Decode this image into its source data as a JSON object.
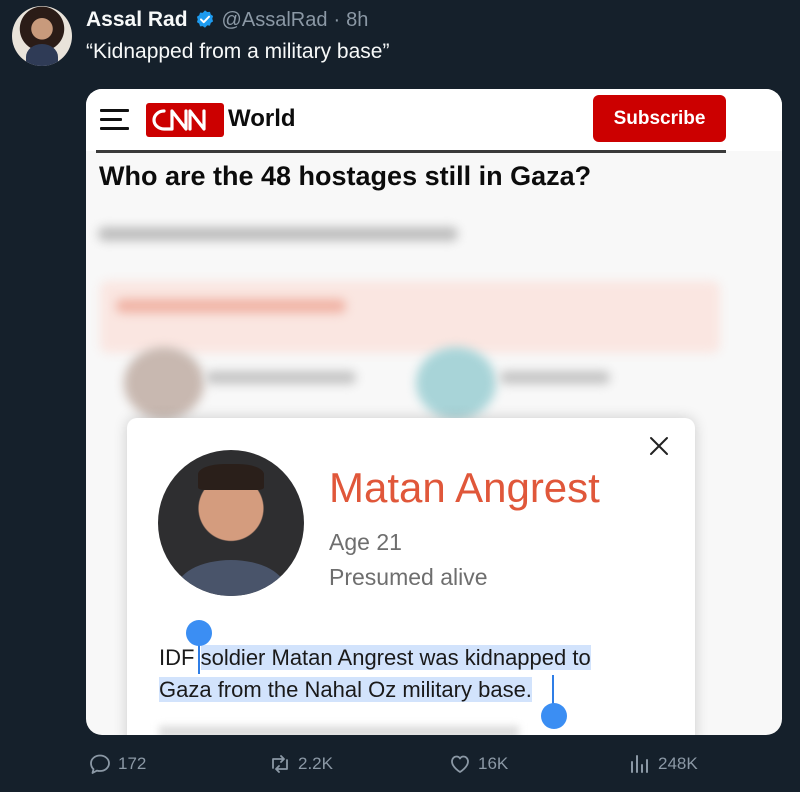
{
  "tweet": {
    "author_name": "Assal Rad",
    "handle": "@AssalRad",
    "separator": "·",
    "time": "8h",
    "text": "“Kidnapped from a military base”"
  },
  "cnn": {
    "section": "World",
    "subscribe_label": "Subscribe",
    "headline": "Who are the 48 hostages still in Gaza?",
    "brand_color": "#cc0000"
  },
  "modal": {
    "name": "Matan Angrest",
    "age": "Age 21",
    "status": "Presumed alive",
    "bio_prefix": "IDF",
    "bio_highlight_1": "soldier Matan Angrest was kidnapped to",
    "bio_highlight_2": "Gaza from the Nahal Oz military base.",
    "name_color": "#e0573a"
  },
  "actions": {
    "replies": "172",
    "reposts": "2.2K",
    "likes": "16K",
    "views": "248K"
  }
}
